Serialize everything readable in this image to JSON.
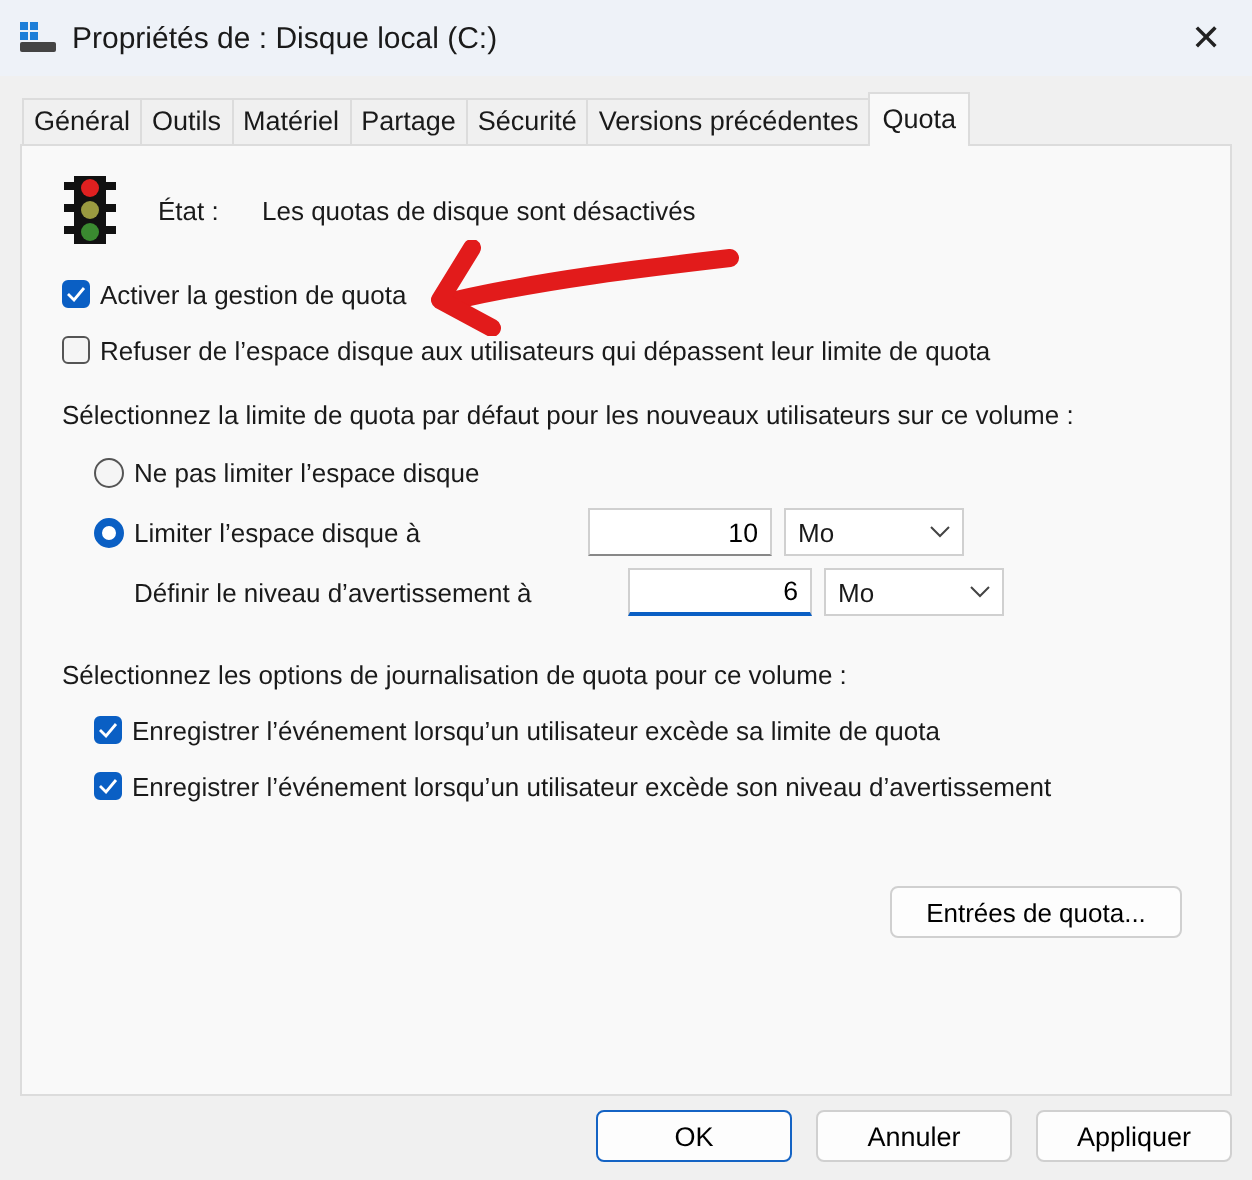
{
  "window": {
    "title": "Propriétés de : Disque local (C:)",
    "close": "✕"
  },
  "tabs": [
    {
      "label": "Général",
      "selected": false
    },
    {
      "label": "Outils",
      "selected": false
    },
    {
      "label": "Matériel",
      "selected": false
    },
    {
      "label": "Partage",
      "selected": false
    },
    {
      "label": "Sécurité",
      "selected": false
    },
    {
      "label": "Versions précédentes",
      "selected": false
    },
    {
      "label": "Quota",
      "selected": true
    }
  ],
  "status": {
    "label": "État :",
    "value": "Les quotas de disque sont désactivés"
  },
  "options": [
    {
      "label": "Activer la gestion de quota",
      "checked": true
    },
    {
      "label": "Refuser de l’espace disque aux utilisateurs qui dépassent leur limite de quota",
      "checked": false
    }
  ],
  "limit_section": {
    "heading": "Sélectionnez la limite de quota par défaut pour les nouveaux utilisateurs sur ce volume :",
    "choices": [
      {
        "label": "Ne pas limiter l’espace disque",
        "selected": false
      },
      {
        "label": "Limiter l’espace disque à",
        "selected": true,
        "value": "10",
        "unit": "Mo"
      }
    ],
    "warning": {
      "label": "Définir le niveau d’avertissement à",
      "value": "6",
      "unit": "Mo"
    }
  },
  "logging_section": {
    "heading": "Sélectionnez les options de journalisation de quota pour ce volume :",
    "options": [
      {
        "label": "Enregistrer l’événement lorsqu’un utilisateur excède sa limite de quota",
        "checked": true
      },
      {
        "label": "Enregistrer l’événement lorsqu’un utilisateur excède son niveau d’avertissement",
        "checked": true
      }
    ]
  },
  "entries_button": "Entrées de quota...",
  "buttons": [
    {
      "label": "OK",
      "kind": "default"
    },
    {
      "label": "Annuler",
      "kind": "normal"
    },
    {
      "label": "Appliquer",
      "kind": "normal"
    }
  ]
}
